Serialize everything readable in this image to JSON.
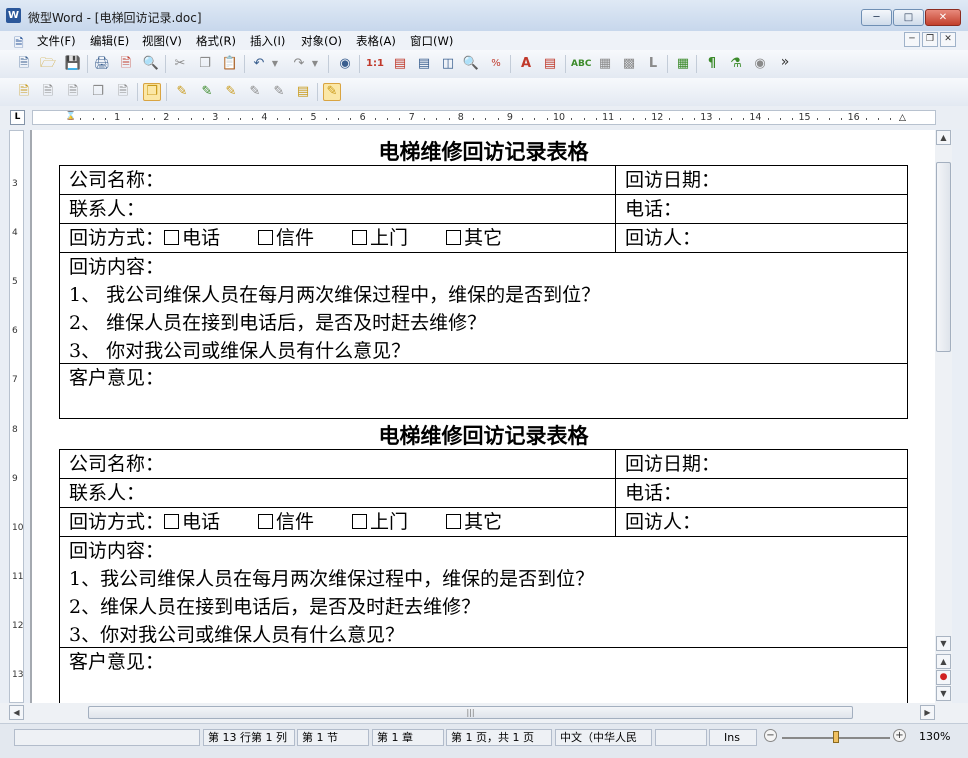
{
  "window": {
    "app_icon": "W",
    "title": "微型Word - [电梯回访记录.doc]",
    "min_icon": "minimize-icon",
    "max_icon": "maximize-icon",
    "close_icon": "close-icon"
  },
  "menu": [
    {
      "label": "文件(F)"
    },
    {
      "label": "编辑(E)"
    },
    {
      "label": "视图(V)"
    },
    {
      "label": "格式(R)"
    },
    {
      "label": "插入(I)"
    },
    {
      "label": "对象(O)"
    },
    {
      "label": "表格(A)"
    },
    {
      "label": "窗口(W)"
    }
  ],
  "toolbar_overflow": "»",
  "ruler": {
    "tab_selector": "L",
    "h_numbers": [
      "1",
      "2",
      "3",
      "4",
      "5",
      "6",
      "7",
      "8",
      "9",
      "10",
      "11",
      "12",
      "13",
      "14",
      "15",
      "16"
    ],
    "v_numbers": [
      "3",
      "4",
      "5",
      "6",
      "7",
      "8",
      "9",
      "10",
      "11",
      "12",
      "13"
    ]
  },
  "document": {
    "forms": [
      {
        "title": "电梯维修回访记录表格",
        "company_label": "公司名称：",
        "date_label": "回访日期：",
        "contact_label": "联系人：",
        "phone_label": "电话：",
        "method_label": "回访方式：",
        "method_options": [
          "电话",
          "信件",
          "上门",
          "其它"
        ],
        "visitor_label": "回访人：",
        "content_label": "回访内容：",
        "questions": [
          "1、    我公司维保人员在每月两次维保过程中，维保的是否到位？",
          "2、    维保人员在接到电话后，是否及时赶去维修？",
          "3、   你对我公司或维保人员有什么意见？"
        ],
        "opinion_label": "客户意见："
      },
      {
        "title": "电梯维修回访记录表格",
        "company_label": "公司名称：",
        "date_label": "回访日期：",
        "contact_label": "联系人：",
        "phone_label": "电话：",
        "method_label": "回访方式：",
        "method_options": [
          "电话",
          "信件",
          "上门",
          "其它"
        ],
        "visitor_label": "回访人：",
        "content_label": "回访内容：",
        "questions": [
          "1、我公司维保人员在每月两次维保过程中，维保的是否到位？",
          "2、维保人员在接到电话后，是否及时赶去维修？",
          "3、你对我公司或维保人员有什么意见？"
        ],
        "opinion_label": "客户意见："
      }
    ]
  },
  "status": {
    "position": "第 13 行第 1 列",
    "section": "第 1 节",
    "chapter": "第 1 章",
    "page": "第 1 页，共 1 页",
    "language": "中文（中华人民",
    "mode": "Ins",
    "zoom": "130%",
    "zoom_fraction": 0.5
  }
}
